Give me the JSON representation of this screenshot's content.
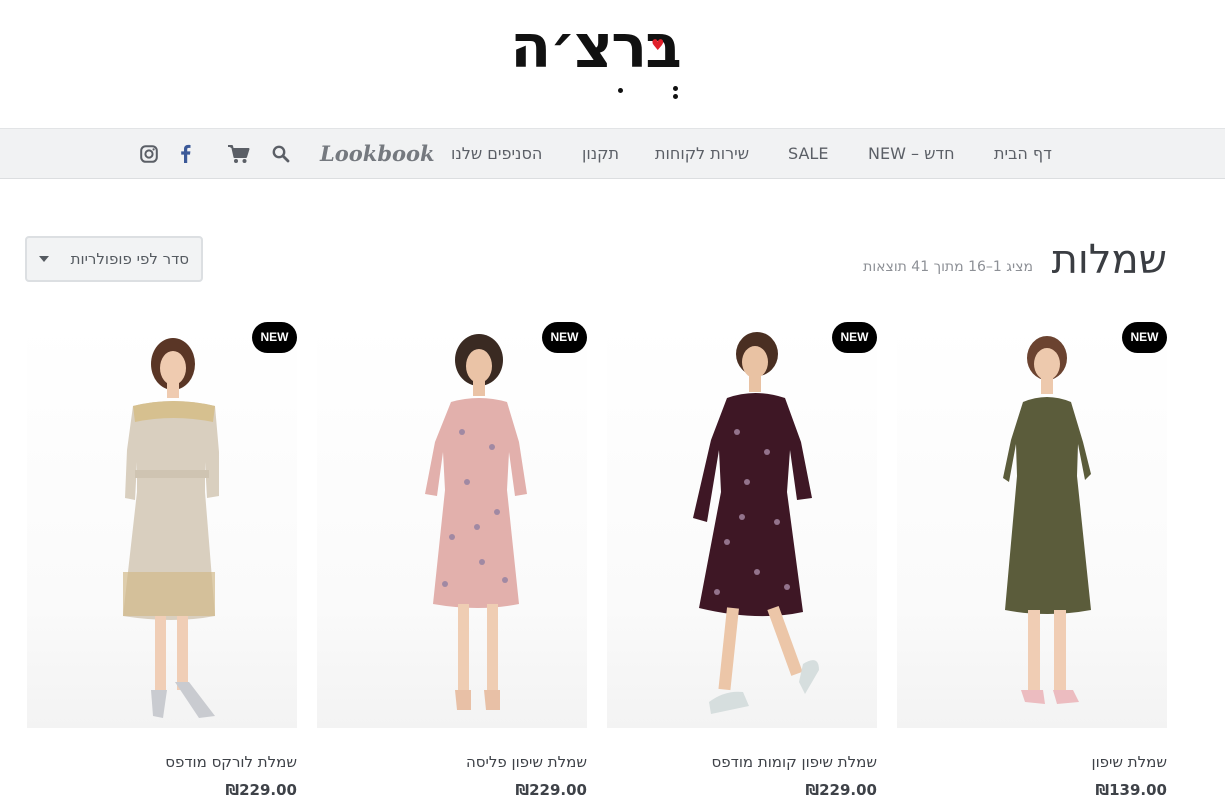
{
  "brand": {
    "logo_text": "ברצ׳ה"
  },
  "nav": {
    "items": [
      "דף הבית",
      "NEW – חדש",
      "SALE",
      "תקנון",
      "שירות לקוחות",
      "הסניפים שלנו"
    ],
    "lookbook": "Lookbook",
    "icons": [
      "search-icon",
      "cart-icon",
      "facebook-icon",
      "instagram-icon"
    ]
  },
  "category": {
    "title": "שמלות",
    "result_count": "מציג 1–16 מתוך 41 תוצאות",
    "sort_label": "סדר לפי פופולריות"
  },
  "colors": {
    "nav_bg": "#f1f2f3",
    "badge_bg": "#000000",
    "logo_heart": "#e0202a"
  },
  "products": [
    {
      "name": "שמלת שיפון",
      "price": "₪139.00",
      "badge": "NEW",
      "dress_color": "#5b5c3b"
    },
    {
      "name": "שמלת שיפון קומות מודפס",
      "price": "₪229.00",
      "badge": "NEW",
      "dress_color": "#3e1725"
    },
    {
      "name": "שמלת שיפון פליסה",
      "price": "₪229.00",
      "badge": "NEW",
      "dress_color": "#e2b0ac"
    },
    {
      "name": "שמלת לורקס מודפס",
      "price": "₪229.00",
      "badge": "NEW",
      "dress_color": "#d9cfbf"
    }
  ]
}
